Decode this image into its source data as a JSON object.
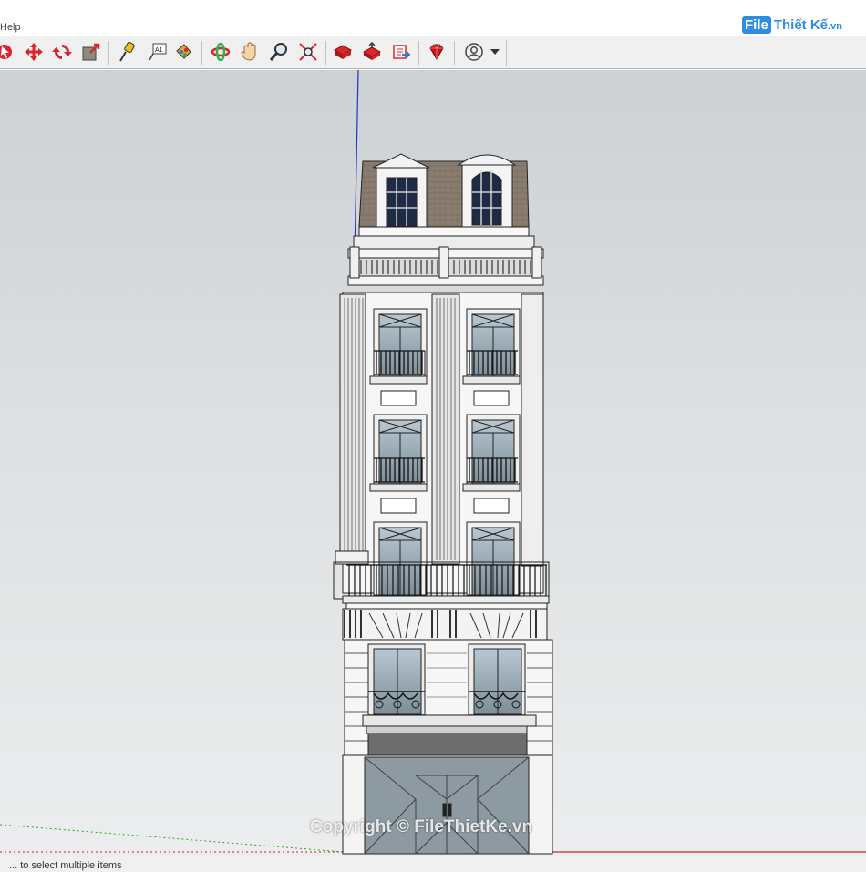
{
  "menubar": {
    "help_label": "Help"
  },
  "logo": {
    "file": "File",
    "brand": "Thiết Kế",
    "domain": ".vn"
  },
  "toolbar": {
    "tools": [
      {
        "name": "select-tool-icon"
      },
      {
        "name": "move-tool-icon"
      },
      {
        "name": "rotate-tool-icon"
      },
      {
        "name": "scale-tool-icon"
      },
      {
        "name": "tape-measure-tool-icon"
      },
      {
        "name": "text-tool-icon"
      },
      {
        "name": "paint-bucket-tool-icon"
      },
      {
        "name": "orbit-tool-icon"
      },
      {
        "name": "pan-tool-icon"
      },
      {
        "name": "zoom-tool-icon"
      },
      {
        "name": "zoom-extents-tool-icon"
      },
      {
        "name": "3d-warehouse-icon"
      },
      {
        "name": "share-model-icon"
      },
      {
        "name": "extension-warehouse-icon"
      },
      {
        "name": "ruby-console-icon"
      },
      {
        "name": "profile-icon"
      }
    ]
  },
  "status": {
    "text": "...  to select multiple items"
  },
  "watermark": {
    "text": "Copyright © FileThietKe.vn"
  },
  "colors": {
    "toolbar_bg": "#f0f0f0",
    "viewport_sky": "#d6d9db",
    "axis_blue": "#2233cc",
    "axis_red": "#cc2222",
    "axis_green": "#22aa22",
    "brand_blue": "#2f8ee0"
  }
}
